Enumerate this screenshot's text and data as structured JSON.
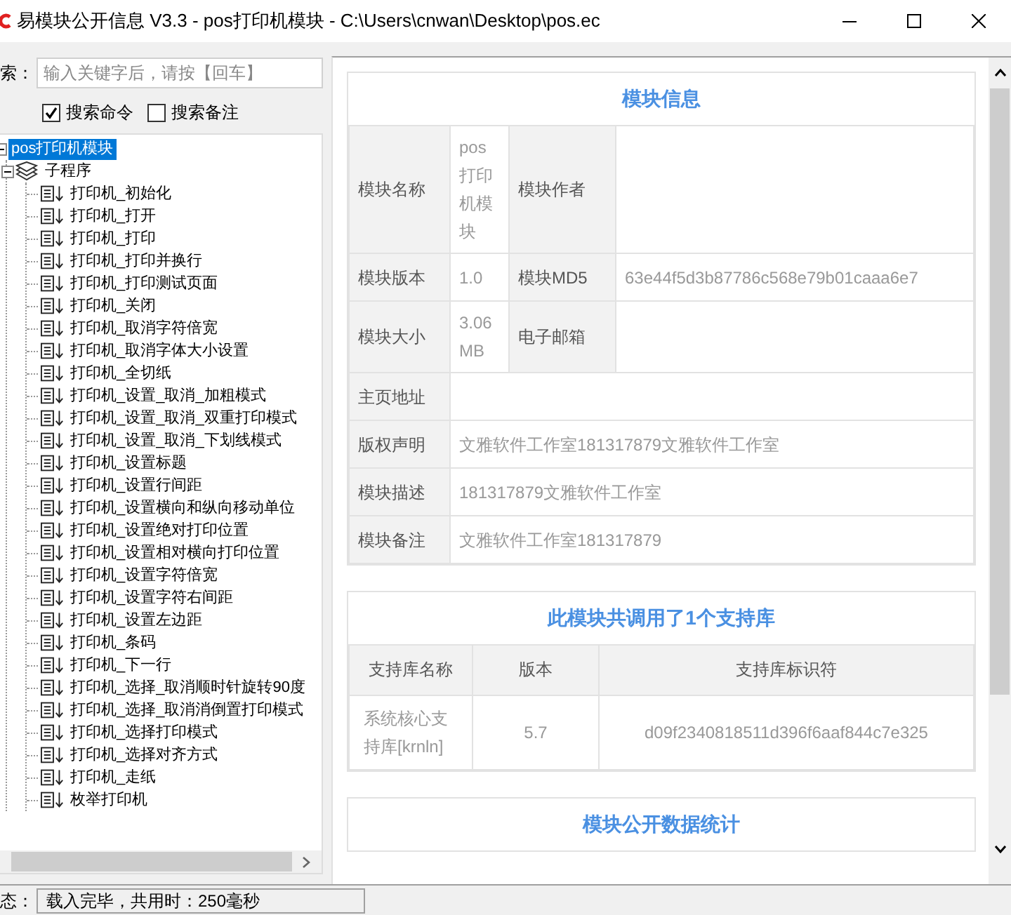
{
  "window": {
    "title": "易模块公开信息 V3.3 - pos打印机模块 - C:\\Users\\cnwan\\Desktop\\pos.ec"
  },
  "search": {
    "label": "索：",
    "placeholder": "输入关键字后，请按【回车】"
  },
  "filters": [
    {
      "label": "搜索命令",
      "checked": true
    },
    {
      "label": "搜索备注",
      "checked": false
    }
  ],
  "tree": [
    {
      "label": "pos打印机模块",
      "selected": true,
      "expanded": true,
      "children": [
        {
          "kind": "group",
          "label": "子程序",
          "selected": false,
          "expanded": true,
          "children": [
            {
              "kind": "sub",
              "label": "打印机_初始化",
              "selected": false
            },
            {
              "kind": "sub",
              "label": "打印机_打开",
              "selected": false
            },
            {
              "kind": "sub",
              "label": "打印机_打印",
              "selected": false
            },
            {
              "kind": "sub",
              "label": "打印机_打印并换行",
              "selected": false
            },
            {
              "kind": "sub",
              "label": "打印机_打印测试页面",
              "selected": false
            },
            {
              "kind": "sub",
              "label": "打印机_关闭",
              "selected": false
            },
            {
              "kind": "sub",
              "label": "打印机_取消字符倍宽",
              "selected": false
            },
            {
              "kind": "sub",
              "label": "打印机_取消字体大小设置",
              "selected": false
            },
            {
              "kind": "sub",
              "label": "打印机_全切纸",
              "selected": false
            },
            {
              "kind": "sub",
              "label": "打印机_设置_取消_加粗模式",
              "selected": false
            },
            {
              "kind": "sub",
              "label": "打印机_设置_取消_双重打印模式",
              "selected": false
            },
            {
              "kind": "sub",
              "label": "打印机_设置_取消_下划线模式",
              "selected": false
            },
            {
              "kind": "sub",
              "label": "打印机_设置标题",
              "selected": false
            },
            {
              "kind": "sub",
              "label": "打印机_设置行间距",
              "selected": false
            },
            {
              "kind": "sub",
              "label": "打印机_设置横向和纵向移动单位",
              "selected": false
            },
            {
              "kind": "sub",
              "label": "打印机_设置绝对打印位置",
              "selected": false
            },
            {
              "kind": "sub",
              "label": "打印机_设置相对横向打印位置",
              "selected": false
            },
            {
              "kind": "sub",
              "label": "打印机_设置字符倍宽",
              "selected": false
            },
            {
              "kind": "sub",
              "label": "打印机_设置字符右间距",
              "selected": false
            },
            {
              "kind": "sub",
              "label": "打印机_设置左边距",
              "selected": false
            },
            {
              "kind": "sub",
              "label": "打印机_条码",
              "selected": false
            },
            {
              "kind": "sub",
              "label": "打印机_下一行",
              "selected": false
            },
            {
              "kind": "sub",
              "label": "打印机_选择_取消顺时针旋转90度",
              "selected": false
            },
            {
              "kind": "sub",
              "label": "打印机_选择_取消消倒置打印模式",
              "selected": false
            },
            {
              "kind": "sub",
              "label": "打印机_选择打印模式",
              "selected": false
            },
            {
              "kind": "sub",
              "label": "打印机_选择对齐方式",
              "selected": false
            },
            {
              "kind": "sub",
              "label": "打印机_走纸",
              "selected": false
            },
            {
              "kind": "sub",
              "label": "枚举打印机",
              "selected": false
            }
          ]
        }
      ]
    }
  ],
  "module_info": {
    "title": "模块信息",
    "rows": [
      {
        "fields": [
          {
            "label": "模块名称",
            "value": "pos打印机模块"
          },
          {
            "label": "模块作者"
          }
        ]
      },
      {
        "fields": [
          {
            "label": "模块版本",
            "value": "1.0"
          },
          {
            "label": "模块MD5",
            "value": "63e44f5d3b87786c568e79b01caaa6e7"
          }
        ]
      },
      {
        "fields": [
          {
            "label": "模块大小",
            "value": "3.06 MB"
          },
          {
            "label": "电子邮箱"
          }
        ]
      },
      {
        "fields": [
          {
            "label": "主页地址"
          }
        ]
      },
      {
        "fields": [
          {
            "label": "版权声明",
            "value": "文雅软件工作室181317879文雅软件工作室"
          }
        ]
      },
      {
        "fields": [
          {
            "label": "模块描述",
            "value": "181317879文雅软件工作室"
          }
        ]
      },
      {
        "fields": [
          {
            "label": "模块备注",
            "value": "文雅软件工作室181317879"
          }
        ]
      }
    ]
  },
  "support_libraries": {
    "title": "此模块共调用了1个支持库",
    "columns": [
      "支持库名称",
      "版本",
      "支持库标识符"
    ],
    "rows": [
      [
        "系统核心支持库[krnln]",
        "5.7",
        "d09f2340818511d396f6aaf844c7e325"
      ]
    ]
  },
  "stats": {
    "title": "模块公开数据统计"
  },
  "status_bar": {
    "label": "态：",
    "text": "载入完毕，共用时：250毫秒"
  }
}
